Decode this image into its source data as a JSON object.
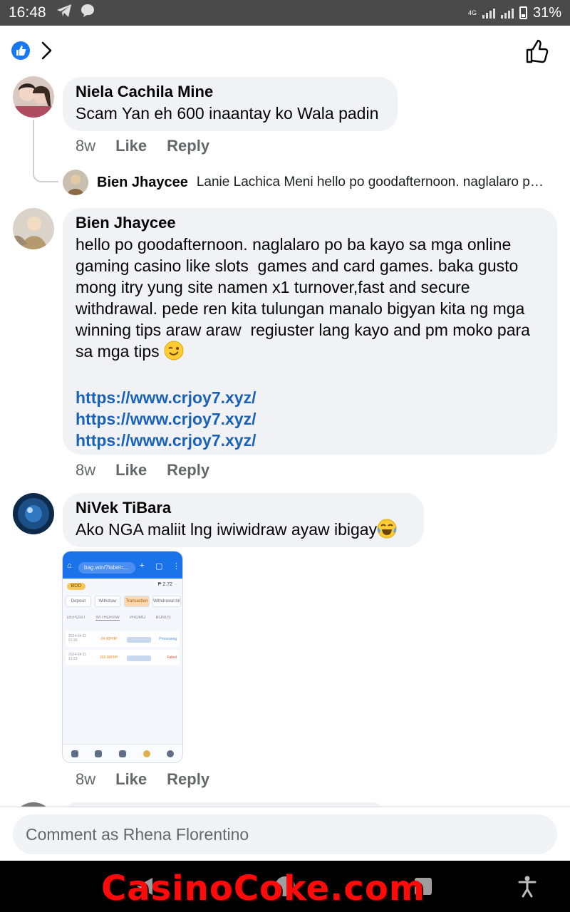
{
  "status_bar": {
    "time": "16:48",
    "battery": "31%",
    "network": "4G"
  },
  "comments": [
    {
      "author": "Niela Cachila Mine",
      "text": "Scam Yan eh 600 inaantay ko Wala padin",
      "time": "8w",
      "like": "Like",
      "reply": "Reply",
      "reply_preview": {
        "author": "Bien Jhaycee",
        "text": "Lanie Lachica Meni  hello po goodafternoon. naglalaro p…"
      }
    },
    {
      "author": "Bien Jhaycee",
      "text": "hello po goodafternoon. naglalaro po ba kayo sa mga online gaming casino like slots  games and card games. baka gusto mong itry yung site namen x1 turnover,fast and secure withdrawal. pede ren kita tulungan manalo bigyan kita ng mga winning tips araw araw  regiuster lang kayo and pm moko para sa mga tips",
      "links": [
        "https://www.crjoy7.xyz/",
        "https://www.crjoy7.xyz/",
        "https://www.crjoy7.xyz/"
      ],
      "time": "8w",
      "like": "Like",
      "reply": "Reply"
    },
    {
      "author": "NiVek TiBara",
      "text": "Ako NGA maliit lng iwiwidraw ayaw ibigay",
      "time": "8w",
      "like": "Like",
      "reply": "Reply",
      "attachment": {
        "url": "bag.win/?label=...",
        "logo": "BDD",
        "balance": "₱ 2.72",
        "buttons": [
          "Deposit",
          "Withdraw",
          "Transaction",
          "Withdrawal binding"
        ],
        "tabs": [
          "DEPOSIT",
          "WITHDRAW",
          "PROMO",
          "BONUS"
        ],
        "rows": [
          {
            "date": "2024-04-11 21:30",
            "amount": "-24.00PHP",
            "status": "Processing"
          },
          {
            "date": "2024-04-11 21:23",
            "amount": "200.00PHP",
            "status": "Failed"
          }
        ],
        "nav": [
          "Home",
          "Refferal",
          "Promotion",
          "Reward",
          "Account"
        ]
      }
    }
  ],
  "composer": {
    "placeholder": "Comment as Rhena Florentino"
  },
  "watermark": "CasinoCoke.com",
  "colors": {
    "link": "#1a62b8",
    "bubble": "#f0f2f5",
    "facebook_blue": "#1877f2",
    "watermark": "#ff0a0a"
  }
}
